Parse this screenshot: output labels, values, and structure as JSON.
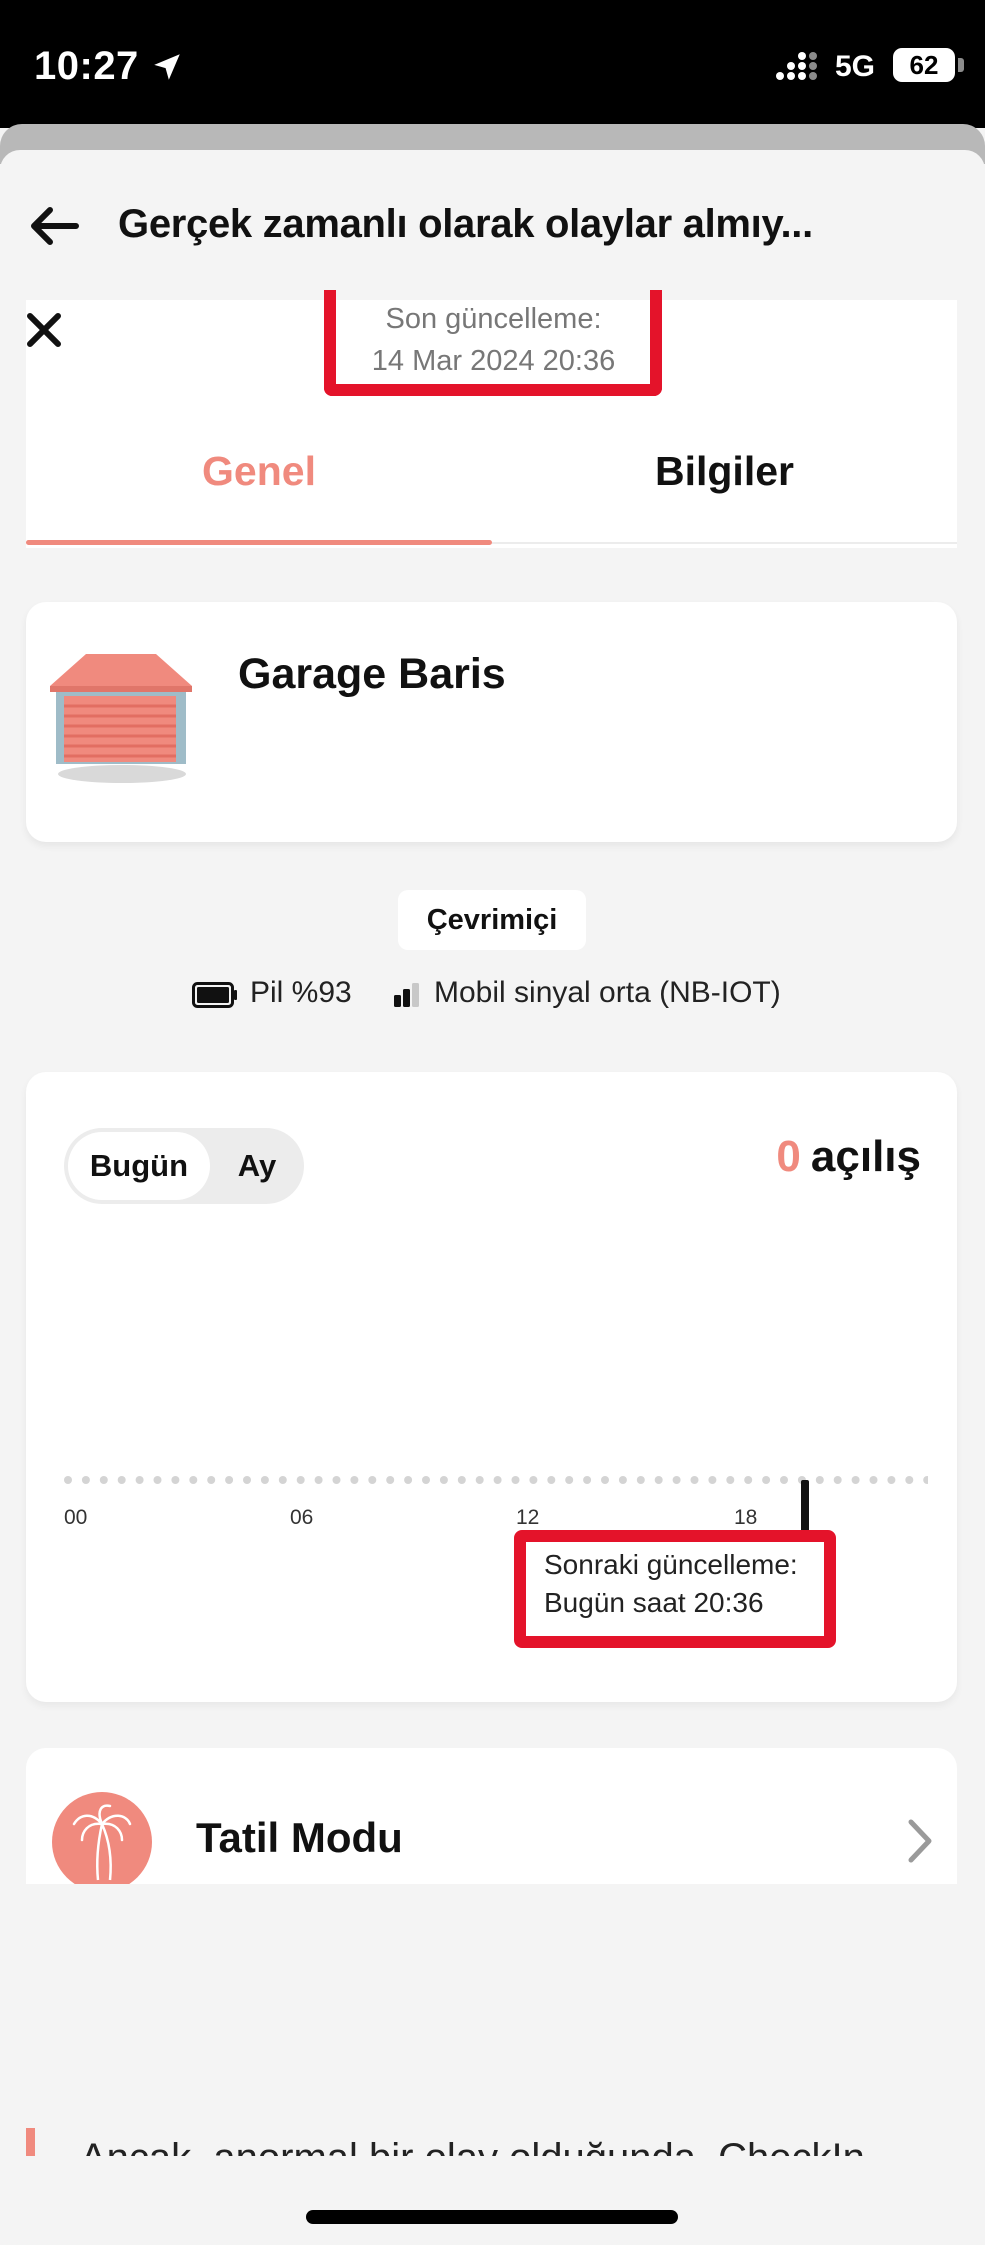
{
  "status_bar": {
    "time": "10:27",
    "network": "5G",
    "battery": "62"
  },
  "header": {
    "title": "Gerçek zamanlı olarak olaylar almıy..."
  },
  "last_update": {
    "line1": "Son güncelleme:",
    "line2": "14 Mar 2024 20:36"
  },
  "tabs": [
    {
      "label": "Genel",
      "active": true
    },
    {
      "label": "Bilgiler",
      "active": false
    }
  ],
  "device": {
    "name": "Garage Baris"
  },
  "status": {
    "online": "Çevrimiçi",
    "battery": "Pil %93",
    "signal": "Mobil sinyal orta (NB-IOT)"
  },
  "chart": {
    "toggle": {
      "today": "Bugün",
      "month": "Ay"
    },
    "open_count": "0",
    "open_label": "açılış",
    "ticks": [
      "00",
      "06",
      "12",
      "18"
    ],
    "next_update": {
      "line1": "Sonraki güncelleme:",
      "line2": "Bugün saat 20:36"
    }
  },
  "holiday_mode": {
    "label": "Tatil Modu"
  },
  "bottom_text": "Ancak, anormal bir olay olduğunda, CheckIn"
}
